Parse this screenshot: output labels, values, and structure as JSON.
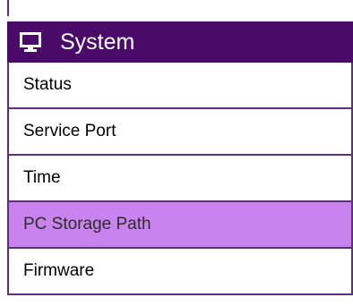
{
  "menu": {
    "header": {
      "icon": "monitor-icon",
      "title": "System"
    },
    "items": [
      {
        "label": "Status",
        "active": false
      },
      {
        "label": "Service Port",
        "active": false
      },
      {
        "label": "Time",
        "active": false
      },
      {
        "label": "PC Storage Path",
        "active": true
      },
      {
        "label": "Firmware",
        "active": false
      }
    ]
  },
  "colors": {
    "header_bg": "#4a0a68",
    "active_bg": "#c983ee",
    "border": "#5a3270"
  }
}
